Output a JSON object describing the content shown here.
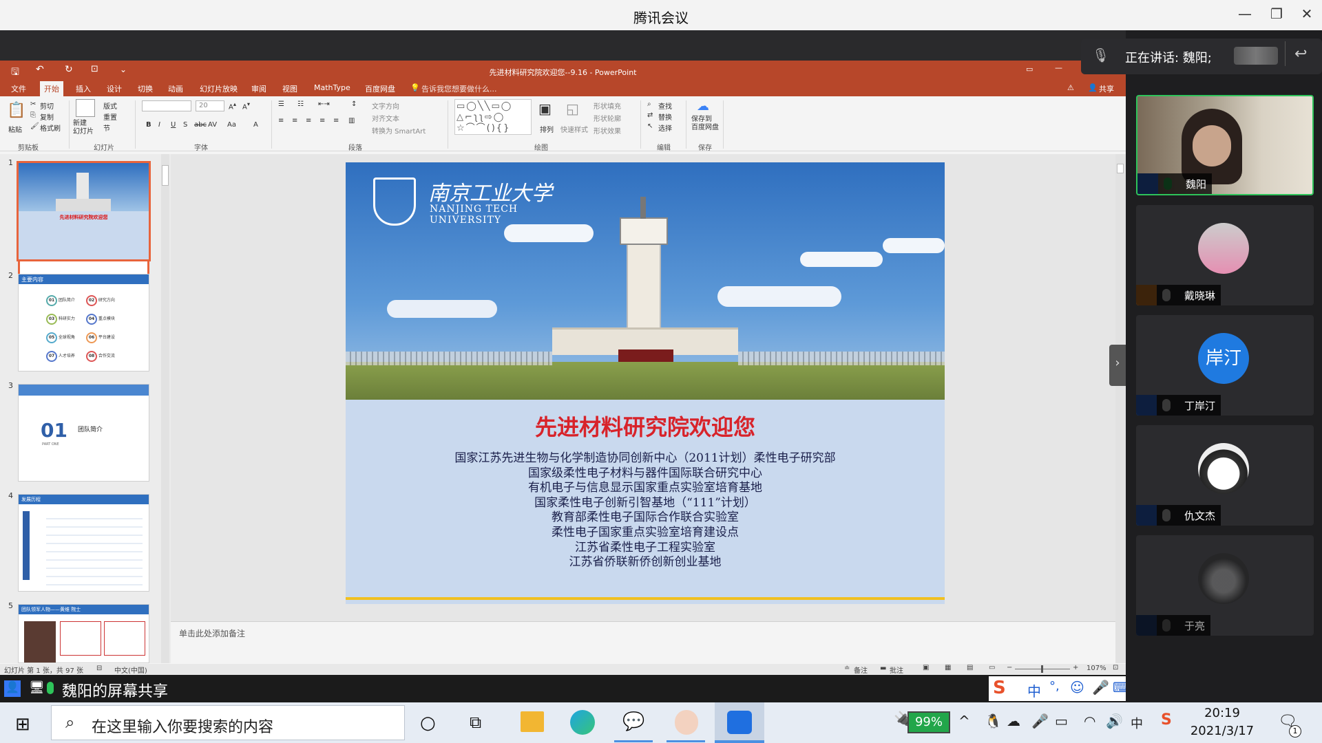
{
  "meeting": {
    "app_title": "腾讯会议",
    "speaking_label": "正在讲话: 魏阳;",
    "share_label": "魏阳的屏幕共享",
    "participants": [
      {
        "name": "魏阳",
        "avatar_text": "",
        "mic": "active"
      },
      {
        "name": "戴晓琳",
        "avatar_text": "",
        "mic": "muted"
      },
      {
        "name": "丁岸汀",
        "avatar_text": "岸汀",
        "mic": "muted"
      },
      {
        "name": "仇文杰",
        "avatar_text": "",
        "mic": "muted"
      },
      {
        "name": "于亮",
        "avatar_text": "",
        "mic": "muted"
      }
    ]
  },
  "ppt": {
    "window_title": "先进材料研究院欢迎您--9.16 - PowerPoint",
    "tabs": [
      "文件",
      "开始",
      "插入",
      "设计",
      "切换",
      "动画",
      "幻灯片放映",
      "审阅",
      "视图",
      "MathType",
      "百度网盘"
    ],
    "tell_me": "告诉我您想要做什么...",
    "share_btn": "共享",
    "ribbon": {
      "paste": "粘贴",
      "cut": "剪切",
      "copy": "复制",
      "format_painter": "格式刷",
      "clipboard": "剪贴板",
      "new_slide": "新建\n幻灯片",
      "layout": "版式",
      "reset": "重置",
      "section": "节",
      "slides": "幻灯片",
      "font_size": "20",
      "font": "字体",
      "text_direction": "文字方向",
      "align_text": "对齐文本",
      "smartart": "转换为 SmartArt",
      "paragraph": "段落",
      "arrange": "排列",
      "quick_styles": "快速样式",
      "shape_fill": "形状填充",
      "shape_outline": "形状轮廓",
      "shape_effects": "形状效果",
      "drawing": "绘图",
      "find": "查找",
      "replace": "替换",
      "select": "选择",
      "editing": "编辑",
      "save_to_baidu": "保存到\n百度网盘",
      "save": "保存"
    },
    "thumbs": [
      {
        "num": "1",
        "caption": "先进材料研究院欢迎您"
      },
      {
        "num": "2",
        "caption": "主要内容",
        "items": [
          "团队简介",
          "研究方向",
          "科研实力",
          "重点模块",
          "全球视角",
          "平台建设",
          "人才培养",
          "合作交流"
        ],
        "codes": [
          "01",
          "02",
          "03",
          "04",
          "05",
          "06",
          "07",
          "08"
        ]
      },
      {
        "num": "3",
        "caption": "团队简介",
        "big": "01",
        "sub": "PART ONE"
      },
      {
        "num": "4",
        "caption": "发展历程"
      },
      {
        "num": "5",
        "caption": "团队领军人物——黄维 院士"
      }
    ],
    "slide": {
      "university_cn": "南京工业大学",
      "university_en_1": "NANJING TECH",
      "university_en_2": "UNIVERSITY",
      "headline": "先进材料研究院欢迎您",
      "lines": [
        "国家江苏先进生物与化学制造协同创新中心（2011计划）柔性电子研究部",
        "国家级柔性电子材料与器件国际联合研究中心",
        "有机电子与信息显示国家重点实验室培育基地",
        "国家柔性电子创新引智基地（“111”计划）",
        "教育部柔性电子国际合作联合实验室",
        "柔性电子国家重点实验室培育建设点",
        "江苏省柔性电子工程实验室",
        "江苏省侨联新侨创新创业基地"
      ]
    },
    "notes_placeholder": "单击此处添加备注",
    "status": {
      "slide_count": "幻灯片 第 1 张，共 97 张",
      "language": "中文(中国)",
      "notes": "备注",
      "comments": "批注",
      "zoom": "107%"
    }
  },
  "taskbar": {
    "search_placeholder": "在这里输入你要搜索的内容",
    "battery": "99%",
    "time": "20:19",
    "date": "2021/3/17",
    "ime": "中",
    "notification_count": "1"
  }
}
